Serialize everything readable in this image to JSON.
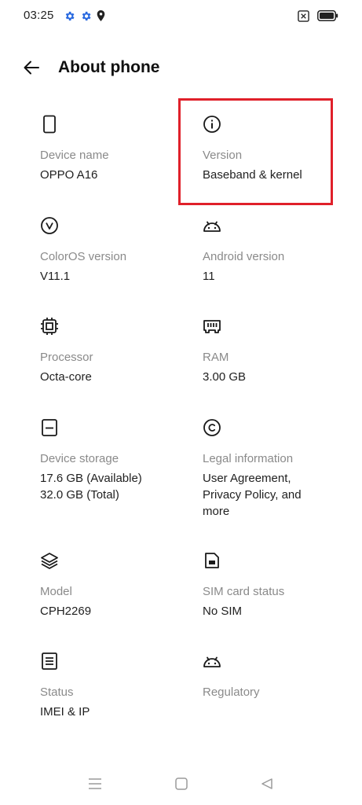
{
  "status_bar": {
    "time": "03:25",
    "left_icons": [
      "gear-icon",
      "gear-icon",
      "location-icon"
    ],
    "right_icons": [
      "no-sim-icon",
      "battery-icon"
    ],
    "accent": "#2a6ae0"
  },
  "header": {
    "title": "About phone",
    "back_icon": "arrow-left-icon"
  },
  "items": [
    {
      "key": "device-name",
      "icon": "phone-icon",
      "label": "Device name",
      "value": "OPPO A16"
    },
    {
      "key": "version",
      "icon": "info-icon",
      "label": "Version",
      "value": "Baseband & kernel",
      "highlighted": true
    },
    {
      "key": "coloros-version",
      "icon": "coloros-v-icon",
      "label": "ColorOS version",
      "value": "V11.1"
    },
    {
      "key": "android-version",
      "icon": "android-icon",
      "label": "Android version",
      "value": "11"
    },
    {
      "key": "processor",
      "icon": "chip-icon",
      "label": "Processor",
      "value": "Octa-core"
    },
    {
      "key": "ram",
      "icon": "ram-icon",
      "label": "RAM",
      "value": "3.00 GB"
    },
    {
      "key": "device-storage",
      "icon": "storage-icon",
      "label": "Device storage",
      "value_lines": [
        "17.6 GB (Available)",
        "32.0 GB (Total)"
      ]
    },
    {
      "key": "legal-information",
      "icon": "copyright-icon",
      "label": "Legal information",
      "value_lines": [
        "User Agreement,",
        "Privacy Policy, and",
        "more"
      ]
    },
    {
      "key": "model",
      "icon": "layers-icon",
      "label": "Model",
      "value": "CPH2269"
    },
    {
      "key": "sim-card-status",
      "icon": "sim-card-icon",
      "label": "SIM card status",
      "value": "No SIM"
    },
    {
      "key": "status",
      "icon": "document-icon",
      "label": "Status",
      "value": "IMEI & IP"
    },
    {
      "key": "regulatory",
      "icon": "android-icon",
      "label": "Regulatory",
      "value": ""
    }
  ],
  "highlight_color": "#e0202a",
  "nav_bar": {
    "buttons": [
      "menu-icon",
      "home-icon",
      "back-triangle-icon"
    ]
  }
}
